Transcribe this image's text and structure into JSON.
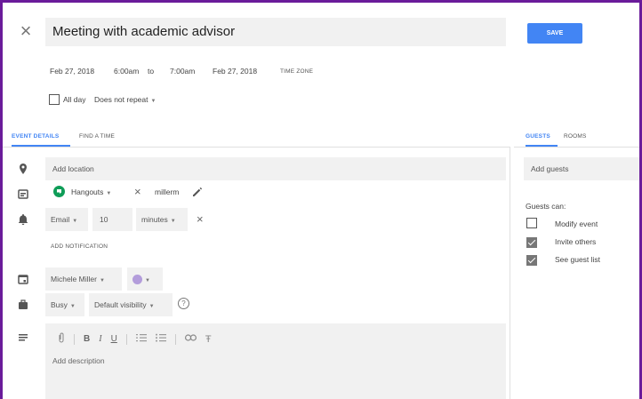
{
  "header": {
    "title": "Meeting with academic advisor",
    "save_label": "SAVE"
  },
  "when": {
    "start_date": "Feb 27, 2018",
    "start_time": "6:00am",
    "to_label": "to",
    "end_time": "7:00am",
    "end_date": "Feb 27, 2018",
    "timezone_label": "TIME ZONE",
    "all_day_label": "All day",
    "repeat_label": "Does not repeat"
  },
  "tabs": {
    "event_details": "EVENT DETAILS",
    "find_time": "FIND A TIME",
    "guests": "GUESTS",
    "rooms": "ROOMS"
  },
  "details": {
    "location_placeholder": "Add location",
    "conference": "Hangouts",
    "conference_id": "millerm",
    "notification_type": "Email",
    "notification_value": "10",
    "notification_unit": "minutes",
    "add_notification": "ADD NOTIFICATION",
    "calendar_owner": "Michele Miller",
    "event_color": "#b39ddb",
    "availability": "Busy",
    "visibility": "Default visibility",
    "description_placeholder": "Add description"
  },
  "guests": {
    "add_placeholder": "Add guests",
    "can_label": "Guests can:",
    "permissions": [
      {
        "label": "Modify event",
        "checked": false
      },
      {
        "label": "Invite others",
        "checked": true
      },
      {
        "label": "See guest list",
        "checked": true
      }
    ]
  },
  "colors": {
    "accent": "#4285f4",
    "frame": "#6a1b9a",
    "hangouts_green": "#0f9d58"
  }
}
